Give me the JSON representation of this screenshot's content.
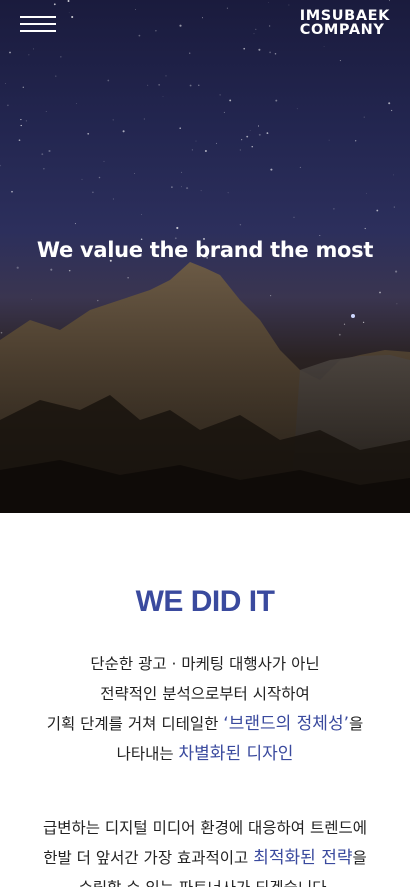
{
  "header": {
    "menu_icon": "hamburger-menu-icon",
    "logo_line1": "IMSUBAEK",
    "logo_line2": "COMPANY"
  },
  "hero": {
    "title": "We value the brand the most"
  },
  "about": {
    "title": "WE DID IT",
    "para1": {
      "line1": "단순한 광고 · 마케팅 대행사가 아닌",
      "line2": "전략적인 분석으로부터 시작하여",
      "line3_pre": "기획 단계를 거쳐 디테일한 ",
      "line3_hl": "‘브랜드의 정체성’",
      "line3_post": "을",
      "line4_pre": "나타내는 ",
      "line4_hl": "차별화된 디자인"
    },
    "para2": {
      "line1": "급변하는 디지털 미디어 환경에 대응하여 트렌드에",
      "line2_pre": "한발 더 앞서간 가장 효과적이고 ",
      "line2_hl": "최적화된 전략",
      "line2_post": "을",
      "line3": "수립할 수 있는 파트너사가 되겠습니다."
    }
  },
  "colors": {
    "accent": "#3a4a9e",
    "text": "#222222"
  }
}
